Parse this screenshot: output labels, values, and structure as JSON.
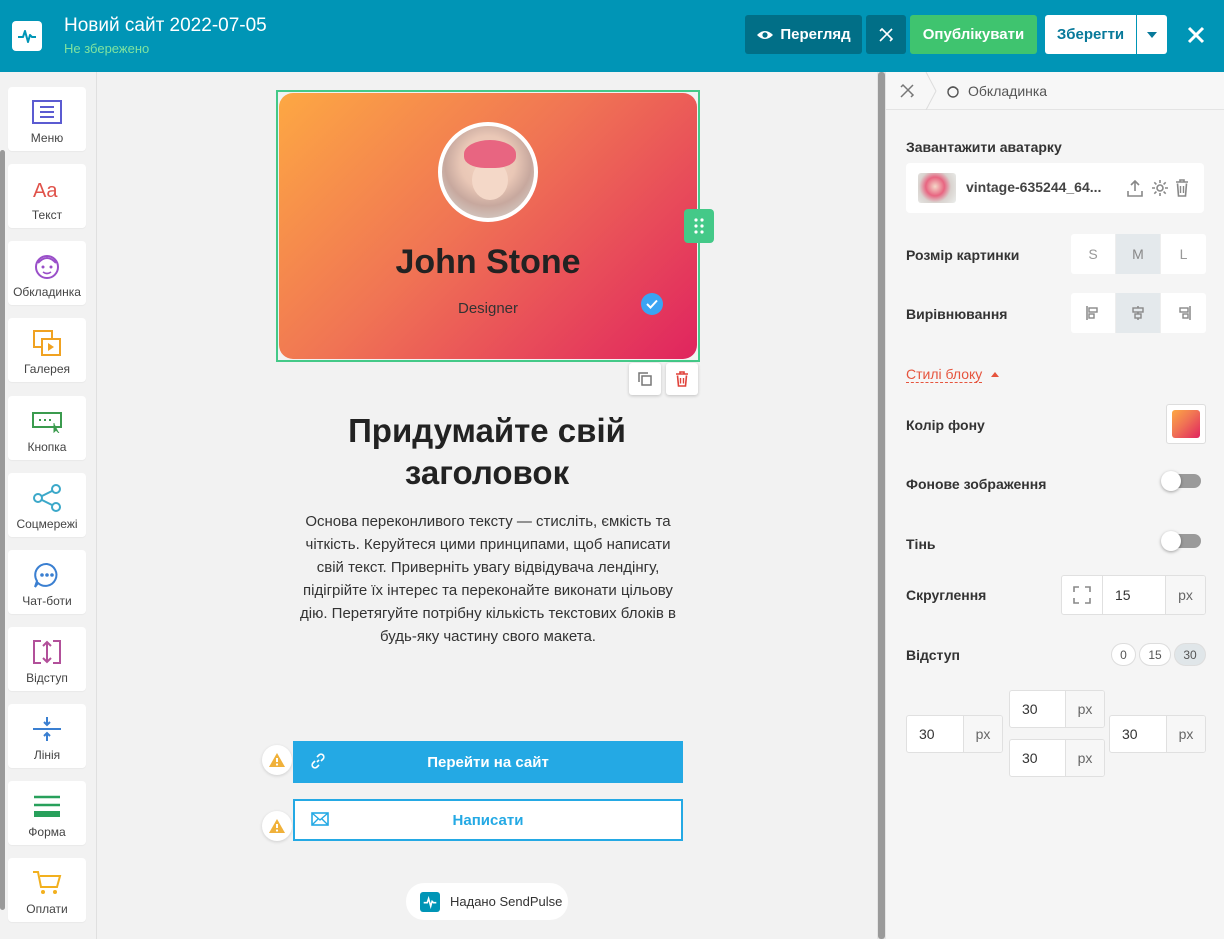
{
  "header": {
    "title": "Новий сайт 2022-07-05",
    "status": "Не збережено",
    "preview_label": "Перегляд",
    "publish_label": "Опублікувати",
    "save_label": "Зберегти"
  },
  "sidebar": {
    "items": [
      {
        "label": "Меню",
        "icon": "menu-icon"
      },
      {
        "label": "Текст",
        "icon": "text-icon"
      },
      {
        "label": "Обкладинка",
        "icon": "cover-icon"
      },
      {
        "label": "Галерея",
        "icon": "gallery-icon"
      },
      {
        "label": "Кнопка",
        "icon": "button-icon"
      },
      {
        "label": "Соцмережі",
        "icon": "share-icon"
      },
      {
        "label": "Чат-боти",
        "icon": "chat-icon"
      },
      {
        "label": "Відступ",
        "icon": "spacing-icon"
      },
      {
        "label": "Лінія",
        "icon": "divider-icon"
      },
      {
        "label": "Форма",
        "icon": "form-icon"
      },
      {
        "label": "Оплати",
        "icon": "cart-icon"
      }
    ]
  },
  "canvas": {
    "cover_name": "John Stone",
    "cover_role": "Designer",
    "heading": "Придумайте свій заголовок",
    "body": "Основа переконливого тексту — стисліть, ємкість та чіткість. Керуйтеся цими принципами, щоб написати свій текст. Приверніть увагу відвідувача лендінгу, підігрійте їх інтерес та переконайте виконати цільову дію. Перетягуйте потрібну кількість текстових блоків в будь-яку частину свого макета.",
    "button1": "Перейти на сайт",
    "button2": "Написати",
    "powered_by": "Надано SendPulse"
  },
  "panel": {
    "breadcrumb_current": "Обкладинка",
    "upload_label": "Завантажити аватарку",
    "file_name": "vintage-635244_64...",
    "size_label": "Розмір картинки",
    "sizes": [
      "S",
      "M",
      "L"
    ],
    "size_selected": "M",
    "align_label": "Вирівнювання",
    "align_selected": "center",
    "styles_link": "Стилі блоку",
    "bg_color_label": "Колір фону",
    "bg_image_label": "Фонове зображення",
    "bg_image_enabled": false,
    "shadow_label": "Тінь",
    "shadow_enabled": false,
    "rounding_label": "Скруглення",
    "rounding_value": "15",
    "unit": "px",
    "padding_label": "Відступ",
    "padding_presets": [
      "0",
      "15",
      "30"
    ],
    "padding_selected": "30",
    "padding": {
      "top": "30",
      "left": "30",
      "right": "30",
      "bottom": "30"
    }
  },
  "colors": {
    "header": "#0095b6",
    "publish": "#3fc46f",
    "accent_button": "#24a9e4",
    "selection": "#44c988",
    "link": "#e6543d",
    "gradient_start": "#fda843",
    "gradient_end": "#e0245f"
  }
}
